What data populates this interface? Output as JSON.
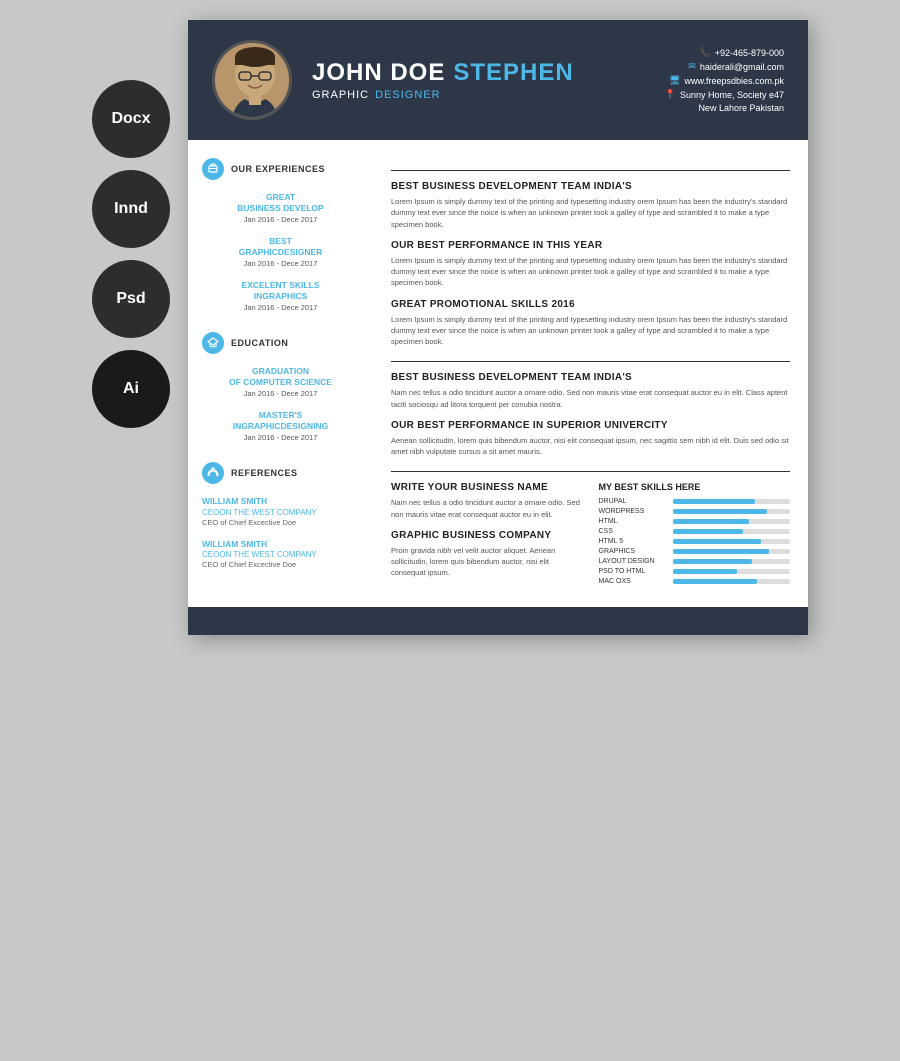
{
  "formats": [
    {
      "label": "Docx",
      "id": "docx"
    },
    {
      "label": "Innd",
      "id": "innd"
    },
    {
      "label": "Psd",
      "id": "psd"
    },
    {
      "label": "Ai",
      "id": "ai"
    }
  ],
  "header": {
    "first_name": "JOHN DOE",
    "last_name": "STEPHEN",
    "title_plain": "GRAPHIC",
    "title_highlight": "DESIGNER",
    "phone": "+92-465-879-000",
    "email": "haiderali@gmail.com",
    "website": "www.freepsdbies.com.pk",
    "address1": "Sunny Home, Society e47",
    "address2": "New Lahore Pakistan"
  },
  "sections": {
    "experiences_title": "OUR EXPERIENCES",
    "education_title": "EDUCATION",
    "references_title": "REFERENCES"
  },
  "experiences_left": [
    {
      "title": "GREAT\nBUSINESS DEVELOP",
      "date": "Jan 2016 - Dece 2017"
    },
    {
      "title": "BEST\nGRAPHICDESIGNER",
      "date": "Jan 2016 - Dece 2017"
    },
    {
      "title": "EXCELENT SKILLS\nINGRAPHICS",
      "date": "Jan 2016 - Dece 2017"
    }
  ],
  "education_left": [
    {
      "title": "GRADUATION\nOF COMPUTER SCIENCE",
      "date": "Jan 2016 - Dece 2017"
    },
    {
      "title": "MASTER'S\nINGRAPHICDESIGNING",
      "date": "Jan 2016 - Dece 2017"
    }
  ],
  "references_left": [
    {
      "name": "WILLIAM SMITH",
      "company": "CEOON THE WEST COMPANY",
      "desc": "CEO of Chief Excective Doe"
    },
    {
      "name": "WILLIAM SMITH",
      "company": "CEOON THE WEST COMPANY",
      "desc": "CEO of Chief Excective Doe"
    }
  ],
  "experiences_right": [
    {
      "title": "BEST BUSINESS DEVELOPMENT TEAM INDIA'S",
      "text": "Lorem Ipsum is simply dummy text of the printing and typesetting industry orem Ipsum has been the industry's standard dummy text ever since the noice is when an unknown printer took a galley of type and scrambled it to make a type specimen book."
    },
    {
      "title": "OUR BEST PERFORMANCE IN THIS YEAR",
      "text": "Lorem Ipsum is simply dummy text of the printing and typesetting industry orem Ipsum has been the industry's standard dummy text ever since the noice is when an unknown printer took a galley of type and scrambled it to make a type specimen book."
    },
    {
      "title": "GREAT PROMOTIONAL SKILLS 2016",
      "text": "Lorem Ipsum is simply dummy text of the printing and typesetting industry orem Ipsum has been the industry's standard dummy text ever since the noice is when an unknown printer took a galley of type and scrambled it to make a type specimen book."
    }
  ],
  "education_right": [
    {
      "title": "BEST BUSINESS DEVELOPMENT TEAM INDIA'S",
      "text": "Nam nec tellus a odio tincidunt auctor a ornare odio. Sed non  mauris vitae erat consequat auctor eu in elit. Class aptent taciti sociosqu ad litora torquent per conubia nostra."
    },
    {
      "title": "OUR BEST PERFORMANCE IN SUPERIOR UNIVERCITY",
      "text": "Aenean sollicitudin, lorem quis bibendum auctor, nisi elit consequat ipsum, nec sagittis sem nibh id elit. Duis sed odio sit amet nibh vulputate cursus a sit amet mauris."
    }
  ],
  "bottom_left_entries": [
    {
      "title": "WRITE YOUR BUSINESS NAME",
      "text": "Nam nec tellus a odio tincidunt auctor a ornare odio. Sed non  mauris vitae erat consequat auctor eu in elit."
    },
    {
      "title": "GRAPHIC BUSINESS COMPANY",
      "text": "Proin gravida nibh vel velit auctor aliquet. Aenean sollicitudin, lorem quis bibendum auctor, nisi elit consequat ipsum."
    }
  ],
  "skills_title": "MY BEST SKILLS HERE",
  "skills": [
    {
      "name": "DRUPAL",
      "pct": 70
    },
    {
      "name": "WORDPRESS",
      "pct": 80
    },
    {
      "name": "HTML",
      "pct": 65
    },
    {
      "name": "CSS",
      "pct": 60
    },
    {
      "name": "HTML 5",
      "pct": 75
    },
    {
      "name": "GRAPHICS",
      "pct": 82
    },
    {
      "name": "LAYOUT DESIGN",
      "pct": 68
    },
    {
      "name": "PSD TO HTML",
      "pct": 55
    },
    {
      "name": "MAC OXS",
      "pct": 72
    }
  ]
}
